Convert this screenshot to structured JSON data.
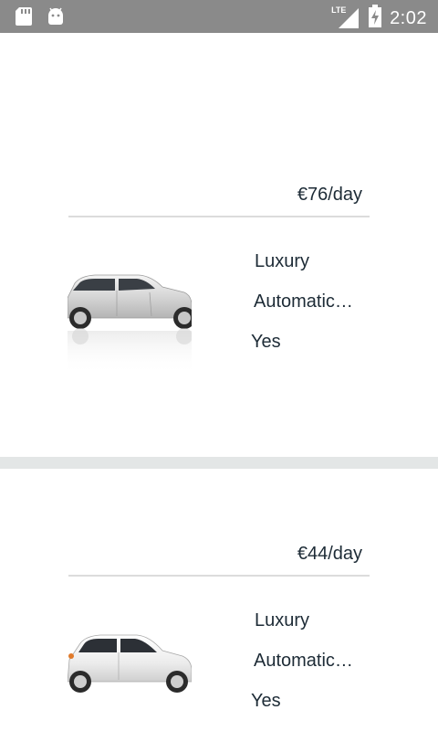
{
  "status_bar": {
    "time": "2:02",
    "network_label": "LTE",
    "icons": [
      "sd-card-icon",
      "android-icon",
      "signal-icon",
      "battery-charging-icon"
    ]
  },
  "cars": [
    {
      "price": "€76/day",
      "category": "Luxury",
      "transmission": "Automatic…",
      "ac": "Yes",
      "image": "silver-wagon-car-image"
    },
    {
      "price": "€44/day",
      "category": "Luxury",
      "transmission": "Automatic…",
      "ac": "Yes",
      "image": "white-hatchback-car-image"
    }
  ]
}
